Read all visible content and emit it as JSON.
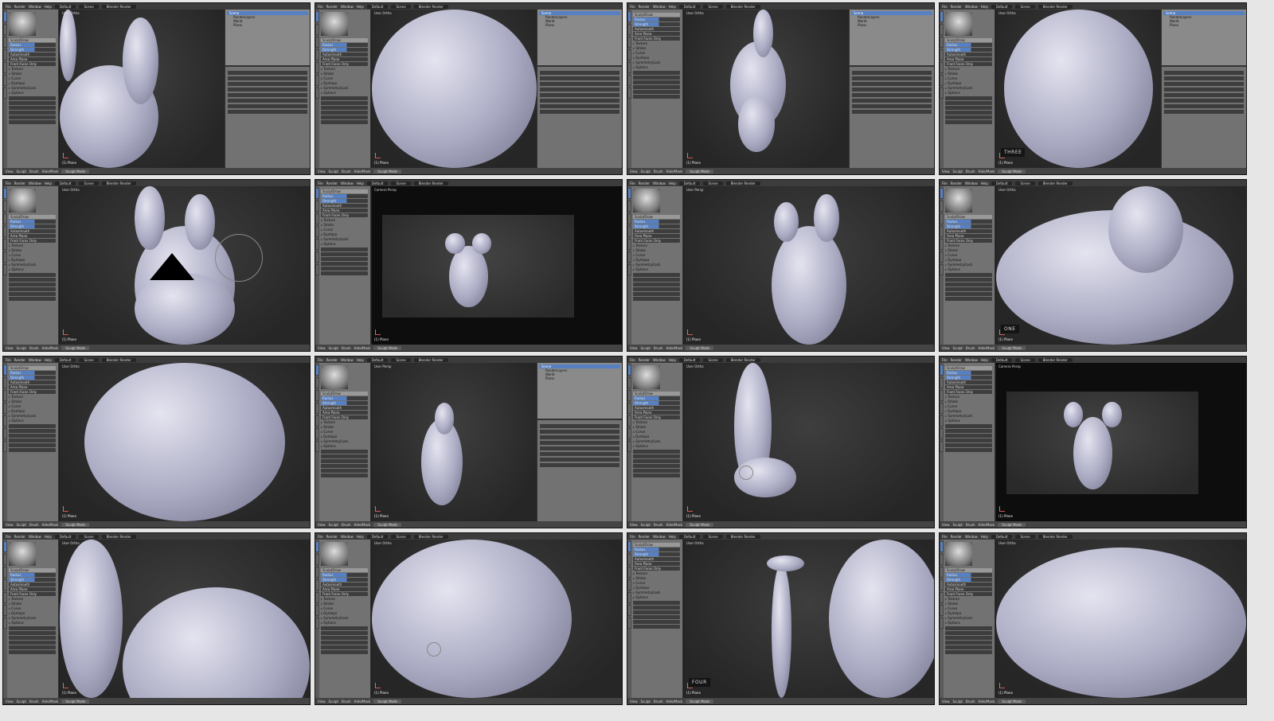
{
  "app": {
    "menu": [
      "File",
      "Render",
      "Window",
      "Help"
    ],
    "layout": "Default",
    "scene": "Scene",
    "engine": "Blender Render",
    "bottom_menu": [
      "View",
      "Sculpt",
      "Brush",
      "Hide/Mask"
    ],
    "mode": "Sculpt Mode",
    "object_label": "(1) Plane"
  },
  "toolshelf": {
    "brush_name": "SculptDraw",
    "fields": [
      "Radius",
      "Strength",
      "Autosmooth",
      "Area Plane",
      "Front Faces Only"
    ],
    "sections": [
      "Texture",
      "Stroke",
      "Curve",
      "Dyntopo",
      "Symmetry/Lock",
      "Options"
    ]
  },
  "outliner": {
    "items": [
      "Scene",
      "RenderLayers",
      "World",
      "Plane"
    ]
  },
  "tiles": [
    {
      "view": "User Ortho",
      "right_panel": true,
      "camera": false,
      "overlay": ""
    },
    {
      "view": "User Ortho",
      "right_panel": true,
      "camera": false,
      "overlay": ""
    },
    {
      "view": "User Ortho",
      "right_panel": true,
      "camera": false,
      "overlay": ""
    },
    {
      "view": "User Ortho",
      "right_panel": true,
      "camera": false,
      "overlay": "THREE"
    },
    {
      "view": "User Ortho",
      "right_panel": false,
      "camera": false,
      "overlay": ""
    },
    {
      "view": "Camera Persp",
      "right_panel": false,
      "camera": true,
      "overlay": ""
    },
    {
      "view": "User Persp",
      "right_panel": false,
      "camera": false,
      "overlay": ""
    },
    {
      "view": "User Ortho",
      "right_panel": false,
      "camera": false,
      "overlay": "ONE"
    },
    {
      "view": "User Ortho",
      "right_panel": false,
      "camera": false,
      "overlay": ""
    },
    {
      "view": "User Persp",
      "right_panel": true,
      "camera": false,
      "overlay": ""
    },
    {
      "view": "User Ortho",
      "right_panel": false,
      "camera": false,
      "overlay": ""
    },
    {
      "view": "Camera Persp",
      "right_panel": false,
      "camera": true,
      "overlay": ""
    },
    {
      "view": "User Ortho",
      "right_panel": false,
      "camera": false,
      "overlay": ""
    },
    {
      "view": "User Ortho",
      "right_panel": false,
      "camera": false,
      "overlay": ""
    },
    {
      "view": "User Ortho",
      "right_panel": false,
      "camera": false,
      "overlay": "FOUR"
    },
    {
      "view": "User Ortho",
      "right_panel": false,
      "camera": false,
      "overlay": ""
    }
  ]
}
